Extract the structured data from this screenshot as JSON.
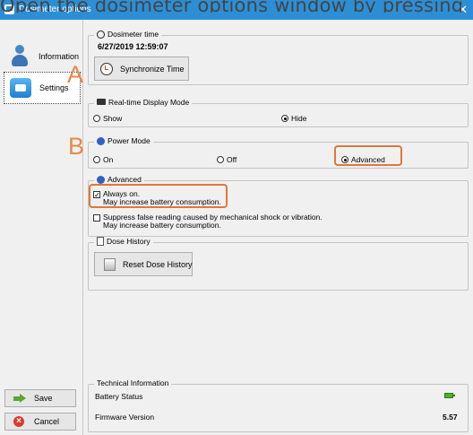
{
  "caption": "Open the dosimeter options window by pressing",
  "window": {
    "title": "Dosimeter options",
    "close_glyph": "✕"
  },
  "sidebar": {
    "items": [
      {
        "label": "Information",
        "icon": "person-icon"
      },
      {
        "label": "Settings",
        "icon": "settings-icon"
      }
    ],
    "save_label": "Save",
    "cancel_label": "Cancel"
  },
  "annotations": {
    "a": "A",
    "b": "B"
  },
  "dosimeter_time": {
    "legend": "Dosimeter time",
    "value": "6/27/2019 12:59:07",
    "sync_label": "Synchronize Time"
  },
  "realtime": {
    "legend": "Real-time Display Mode",
    "show_label": "Show",
    "hide_label": "Hide",
    "selected": "Hide"
  },
  "power": {
    "legend": "Power Mode",
    "on_label": "On",
    "off_label": "Off",
    "advanced_label": "Advanced",
    "selected": "Advanced"
  },
  "advanced": {
    "legend": "Advanced",
    "always_on_line1": "Always on.",
    "always_on_line2": "May increase battery consumption.",
    "always_on_checked": true,
    "suppress_line1": "Suppress false reading caused by mechanical shock or vibration.",
    "suppress_line2": "May increase battery consumption.",
    "suppress_checked": false
  },
  "dose_history": {
    "legend": "Dose History",
    "reset_label": "Reset Dose History"
  },
  "tech": {
    "legend": "Technical Information",
    "battery_label": "Battery Status",
    "firmware_label": "Firmware Version",
    "firmware_value": "5.57"
  },
  "colors": {
    "titlebar": "#2c8fd6",
    "highlight": "#e2763a",
    "radio_icon": "#2e62c4"
  }
}
